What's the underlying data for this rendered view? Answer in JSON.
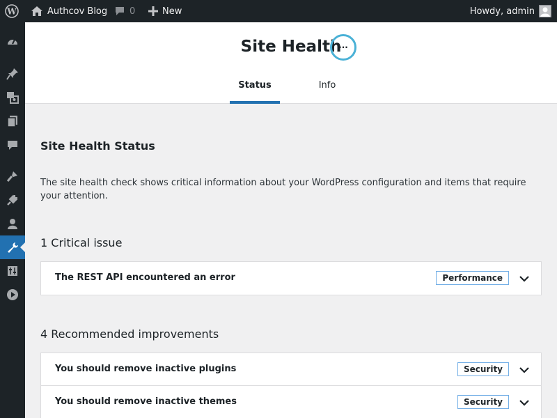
{
  "adminbar": {
    "site_name": "Authcov Blog",
    "comment_count": "0",
    "new_label": "New",
    "howdy": "Howdy, admin"
  },
  "menu": {
    "icons": [
      "dashboard-icon",
      "posts-icon",
      "media-icon",
      "pages-icon",
      "comments-icon",
      "appearance-icon",
      "plugins-icon",
      "users-icon",
      "tools-icon",
      "settings-icon",
      "media-player-icon"
    ],
    "current": "tools-icon"
  },
  "header": {
    "title": "Site Health",
    "score_text": "···",
    "tabs": [
      {
        "label": "Status",
        "active": true
      },
      {
        "label": "Info",
        "active": false
      }
    ]
  },
  "status": {
    "title": "Site Health Status",
    "description": "The site health check shows critical information about your WordPress configuration and items that require your attention.",
    "critical_title": "1 Critical issue",
    "critical": [
      {
        "label": "The REST API encountered an error",
        "badge": "Performance"
      }
    ],
    "recommended_title": "4 Recommended improvements",
    "recommended": [
      {
        "label": "You should remove inactive plugins",
        "badge": "Security"
      },
      {
        "label": "You should remove inactive themes",
        "badge": "Security"
      }
    ]
  },
  "colors": {
    "adminbar_bg": "#1d2327",
    "accent": "#2271b1",
    "badge_border": "#72aee6",
    "score_ring": "#4ab1d6"
  }
}
